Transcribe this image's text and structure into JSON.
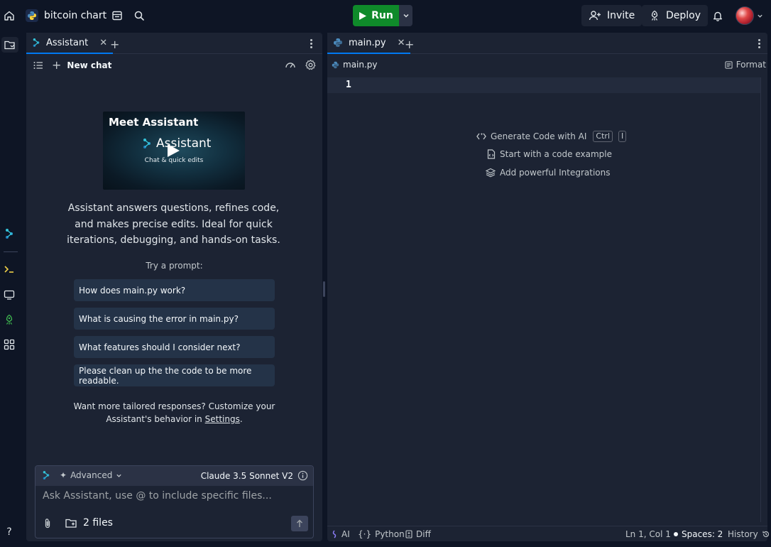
{
  "app": {
    "repl_name": "bitcoin chart",
    "run_label": "Run",
    "invite_label": "Invite",
    "deploy_label": "Deploy"
  },
  "assistant": {
    "tab_label": "Assistant",
    "new_chat_label": "New chat",
    "video_title": "Meet Assistant",
    "video_brand": "Assistant",
    "video_subtitle": "Chat & quick edits",
    "intro_text": "Assistant answers questions, refines code, and makes precise edits. Ideal for quick iterations, debugging, and hands-on tasks.",
    "try_label": "Try a prompt:",
    "prompts": [
      "How does main.py work?",
      "What is causing the error in main.py?",
      "What features should I consider next?",
      "Please clean up the the code to be more readable."
    ],
    "custom_note_prefix": "Want more tailored responses? Customize your Assistant's behavior in",
    "custom_note_link": "Settings",
    "custom_note_suffix": ".",
    "mode_label": "Advanced",
    "model_label": "Claude 3.5 Sonnet V2",
    "input_placeholder": "Ask Assistant, use @ to include specific files...",
    "files_label": "2 files"
  },
  "editor": {
    "tab_label": "main.py",
    "breadcrumb": "main.py",
    "format_label": "Format",
    "line_number": "1",
    "hints": {
      "generate": "Generate Code with AI",
      "kbd_ctrl": "Ctrl",
      "kbd_i": "I",
      "example": "Start with a code example",
      "integrations": "Add powerful Integrations"
    },
    "status": {
      "ai": "AI",
      "language": "Python",
      "diff": "Diff",
      "cursor": "Ln 1, Col 1",
      "spaces": "Spaces: 2",
      "history": "History"
    }
  },
  "colors": {
    "background": "#0e1525",
    "panel": "#1c2333",
    "run_green": "#0f8a2a",
    "prompt_bg": "#243348",
    "accent_blue": "#0079f2"
  },
  "icons": [
    "home-icon",
    "python-logo-icon",
    "layout-icon",
    "search-icon",
    "play-icon",
    "chevron-down-icon",
    "add-user-icon",
    "deploy-icon",
    "bell-icon",
    "avatar",
    "files-icon",
    "assistant-icon",
    "shell-icon",
    "monitor-icon",
    "deploy-rail-icon",
    "apps-icon",
    "help-icon"
  ]
}
